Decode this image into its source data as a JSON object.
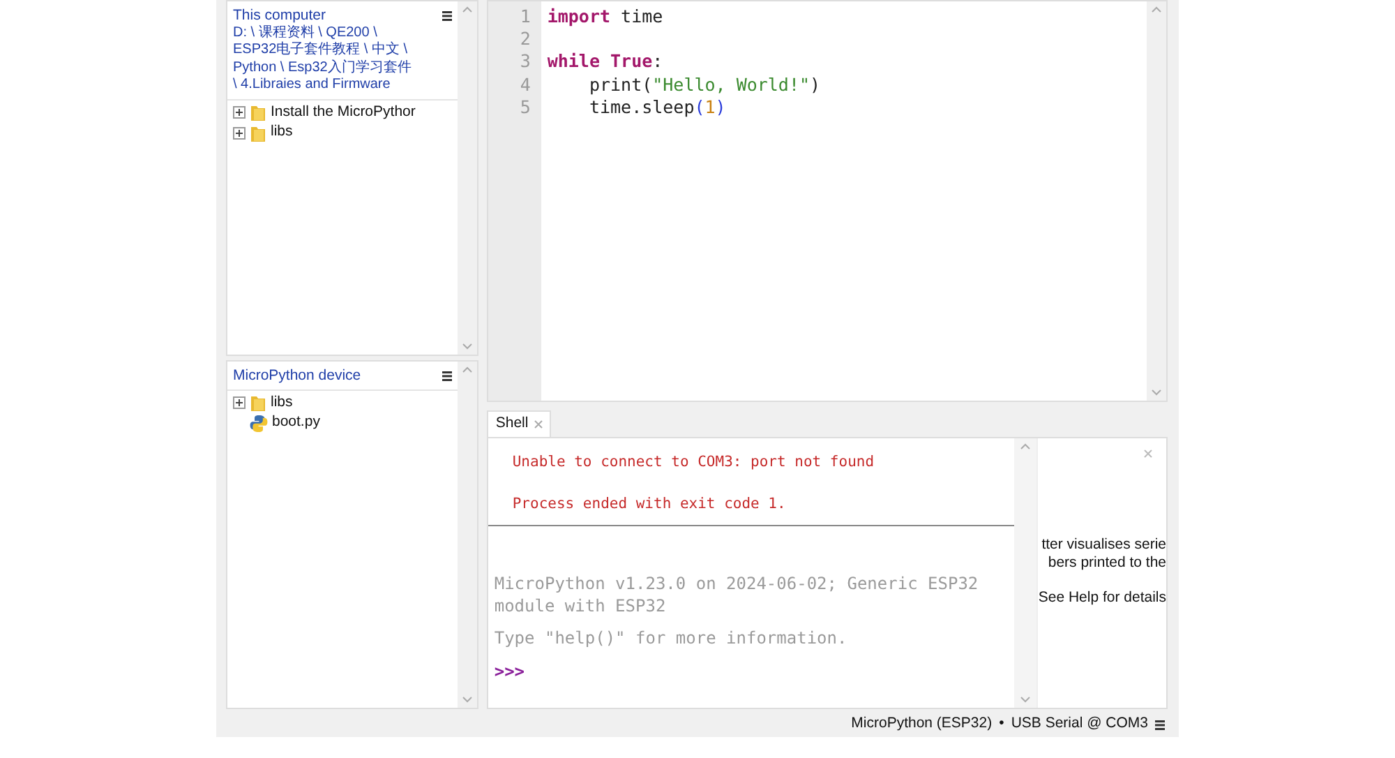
{
  "this_computer": {
    "title": "This computer",
    "path": "D: \\ 课程资料 \\ QE200 \\ ESP32电子套件教程 \\ 中文 \\ Python \\ Esp32入门学习套件 \\ 4.Libraies and Firmware",
    "items": [
      {
        "label": "Install the MicroPythor",
        "kind": "folder",
        "expandable": true
      },
      {
        "label": "libs",
        "kind": "folder",
        "expandable": true
      }
    ]
  },
  "device": {
    "title": "MicroPython device",
    "items": [
      {
        "label": "libs",
        "kind": "folder",
        "expandable": true
      },
      {
        "label": "boot.py",
        "kind": "python",
        "expandable": false
      }
    ]
  },
  "editor": {
    "lines": [
      {
        "number": "1",
        "tokens": [
          {
            "text": "import",
            "kind": "keyword"
          },
          {
            "text": " time",
            "kind": "plain"
          }
        ]
      },
      {
        "number": "2"
      },
      {
        "number": "3",
        "tokens": [
          {
            "text": "while ",
            "kind": "keyword"
          },
          {
            "text": "True",
            "kind": "keyword"
          },
          {
            "text": ":",
            "kind": "plain"
          }
        ]
      },
      {
        "number": "4",
        "tokens": [
          {
            "text": "    print(",
            "kind": "plain"
          },
          {
            "text": "\"Hello, World!\"",
            "kind": "string"
          },
          {
            "text": ")",
            "kind": "plain"
          }
        ]
      },
      {
        "number": "5",
        "tokens": [
          {
            "text": "    time.sleep",
            "kind": "plain"
          },
          {
            "text": "(",
            "kind": "paren"
          },
          {
            "text": "1",
            "kind": "number"
          },
          {
            "text": ")",
            "kind": "paren"
          }
        ]
      }
    ]
  },
  "shell": {
    "tab": {
      "label": "Shell",
      "selected": true
    },
    "lines": [
      {
        "text": "Unable to connect to COM3: port not found",
        "kind": "error"
      },
      {
        "text": "Process ended with exit code 1.",
        "kind": "error"
      },
      {
        "kind": "separator"
      },
      {
        "text": "MicroPython v1.23.0 on 2024-06-02; Generic ESP32 module with ESP32",
        "kind": "info"
      },
      {
        "text": "Type \"help()\" for more information.",
        "kind": "info"
      },
      {
        "text": ">>>",
        "kind": "prompt"
      }
    ]
  },
  "plotter": {
    "lines": [
      "tter visualises serie",
      "bers printed to the",
      "See Help for details"
    ]
  },
  "status_bar": {
    "interpreter": "MicroPython (ESP32)",
    "separator": "•",
    "port": "USB Serial @ COM3"
  }
}
